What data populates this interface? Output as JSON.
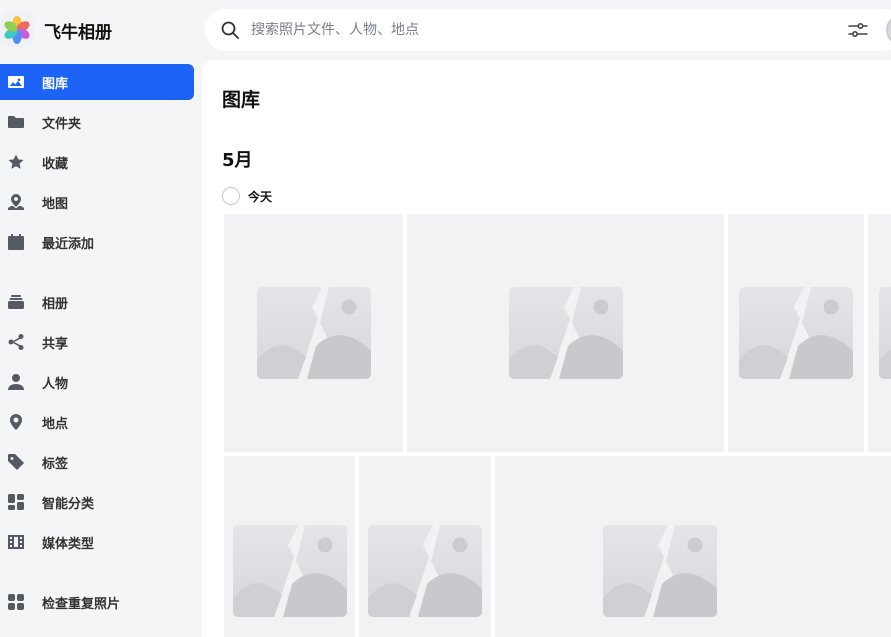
{
  "app": {
    "name": "飞牛相册"
  },
  "search": {
    "placeholder": "搜索照片文件、人物、地点"
  },
  "sidebar": {
    "items": [
      {
        "label": "图库",
        "icon": "photo-library-icon",
        "active": true
      },
      {
        "label": "文件夹",
        "icon": "folder-icon"
      },
      {
        "label": "收藏",
        "icon": "star-icon"
      },
      {
        "label": "地图",
        "icon": "map-icon"
      },
      {
        "label": "最近添加",
        "icon": "calendar-icon"
      },
      {
        "label": "相册",
        "icon": "album-stack-icon"
      },
      {
        "label": "共享",
        "icon": "share-icon"
      },
      {
        "label": "人物",
        "icon": "person-icon"
      },
      {
        "label": "地点",
        "icon": "location-pin-icon"
      },
      {
        "label": "标签",
        "icon": "tag-icon"
      },
      {
        "label": "智能分类",
        "icon": "smart-category-icon"
      },
      {
        "label": "媒体类型",
        "icon": "film-icon"
      },
      {
        "label": "检查重复照片",
        "icon": "duplicate-check-icon"
      }
    ]
  },
  "main": {
    "title": "图库",
    "month": "5月",
    "day_group": "今天"
  },
  "colors": {
    "accent": "#1d63f5",
    "placeholder_bg": "#f1f2f4"
  }
}
